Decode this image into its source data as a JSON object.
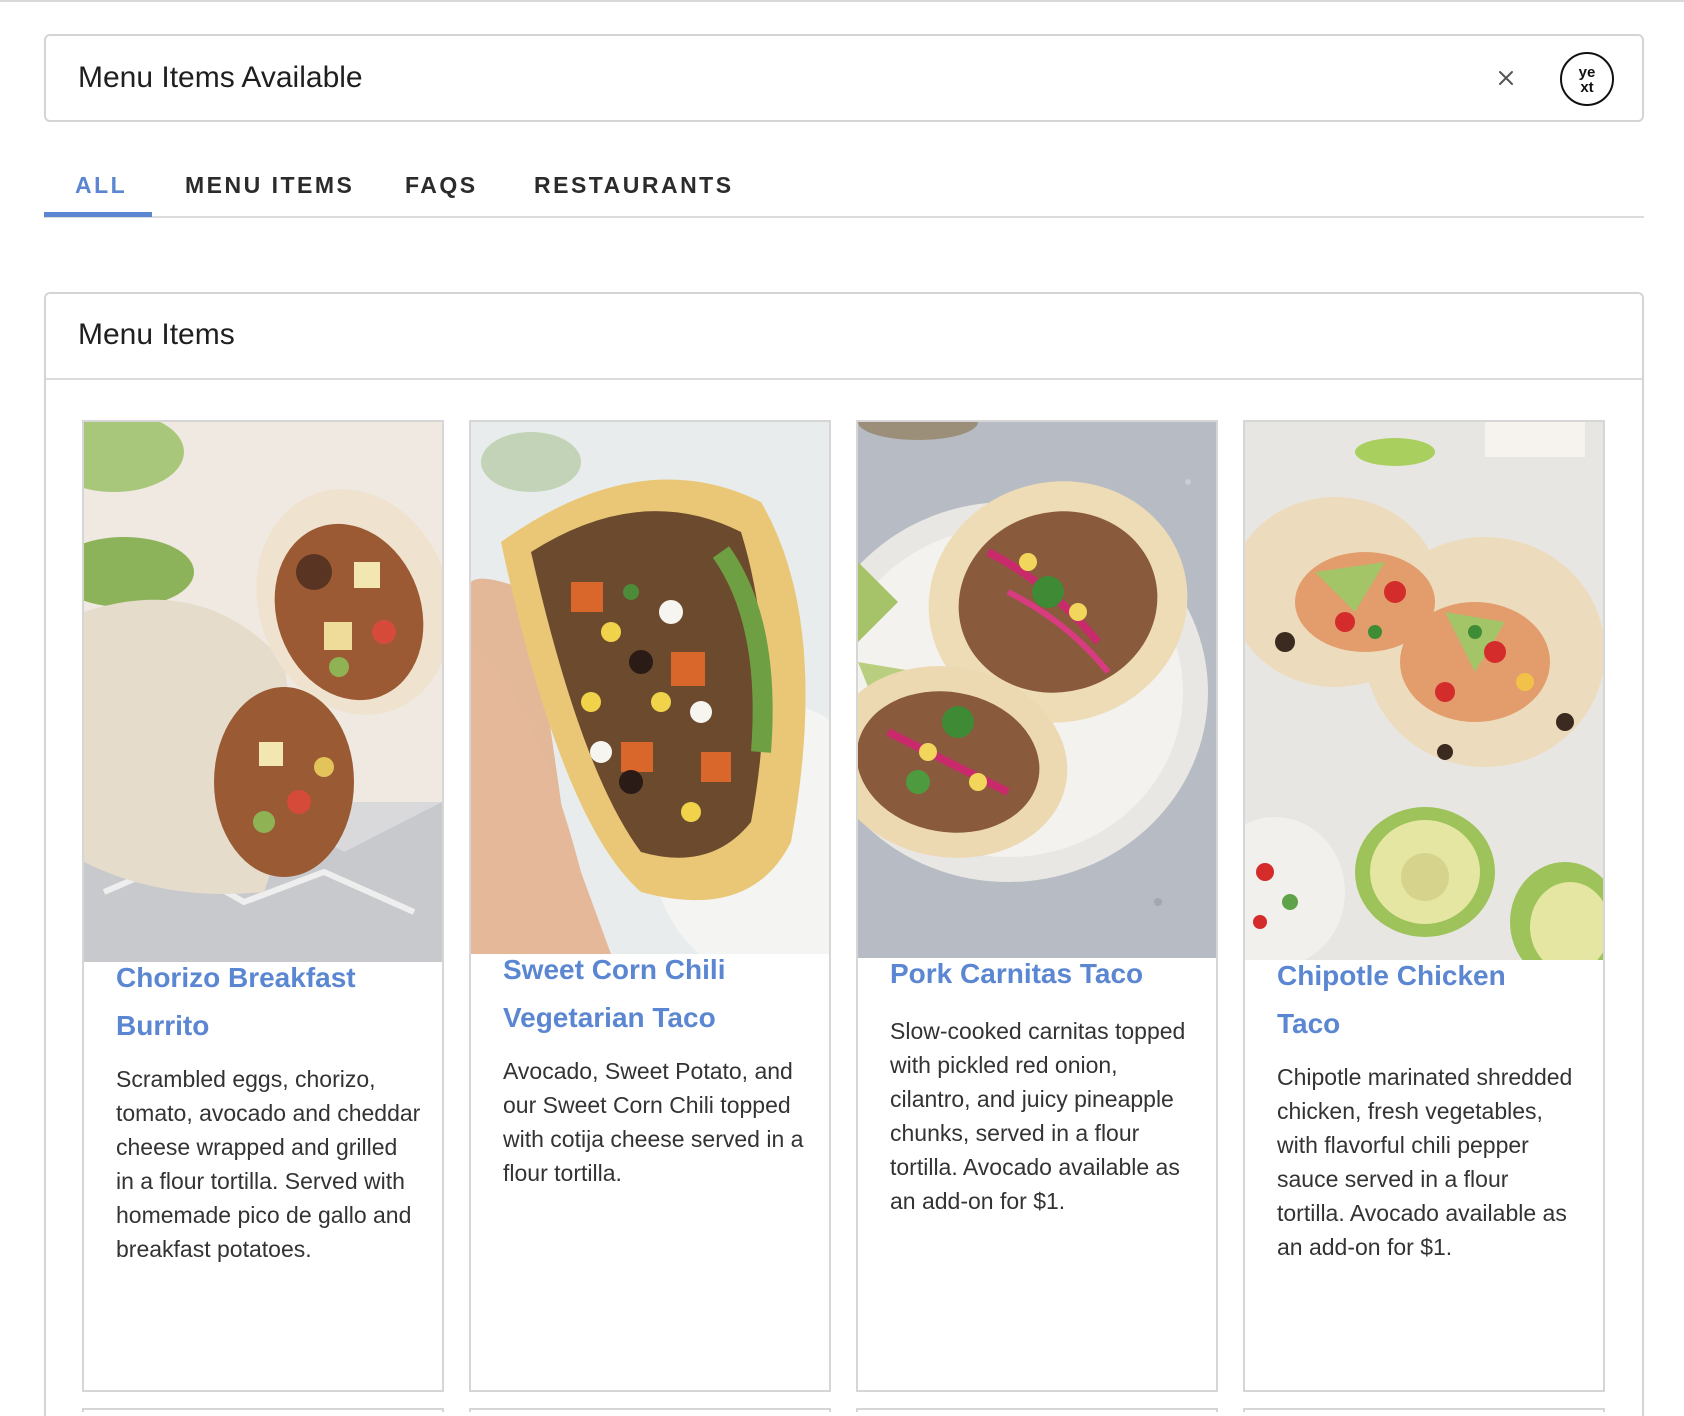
{
  "search": {
    "value": "Menu Items Available",
    "clear_icon": "close-icon",
    "logo_text_top": "ye",
    "logo_text_bottom": "xt"
  },
  "tabs": [
    {
      "label": "ALL",
      "active": true
    },
    {
      "label": "MENU ITEMS",
      "active": false
    },
    {
      "label": "FAQS",
      "active": false
    },
    {
      "label": "RESTAURANTS",
      "active": false
    }
  ],
  "section": {
    "title": "Menu Items",
    "cards": [
      {
        "title_line1": "Chorizo Breakfast",
        "title_line2": "Burrito",
        "description": "Scrambled eggs, chorizo, tomato, avocado and cheddar cheese wrapped and grilled in a flour tortilla. Served with homemade pico de gallo and breakfast potatoes.",
        "image_icon": "burrito-photo"
      },
      {
        "title_line1": "Sweet Corn Chili",
        "title_line2": "Vegetarian Taco",
        "description": "Avocado, Sweet Potato, and our Sweet Corn Chili topped with cotija cheese served in a flour tortilla.",
        "image_icon": "veggie-taco-photo"
      },
      {
        "title_line1": "Pork Carnitas Taco",
        "title_line2": "",
        "description": "Slow-cooked carnitas topped with pickled red onion, cilantro, and juicy pineapple chunks, served in a flour tortilla. Avocado available as an add-on for $1.",
        "image_icon": "carnitas-taco-photo"
      },
      {
        "title_line1": "Chipotle Chicken",
        "title_line2": "Taco",
        "description": "Chipotle marinated shredded chicken, fresh vegetables, with flavorful chili pepper sauce served in a flour tortilla. Avocado available as an add-on for $1.",
        "image_icon": "chicken-taco-photo"
      }
    ]
  },
  "colors": {
    "accent": "#5b86d1",
    "border": "#d4d4d4",
    "text": "#222222"
  }
}
